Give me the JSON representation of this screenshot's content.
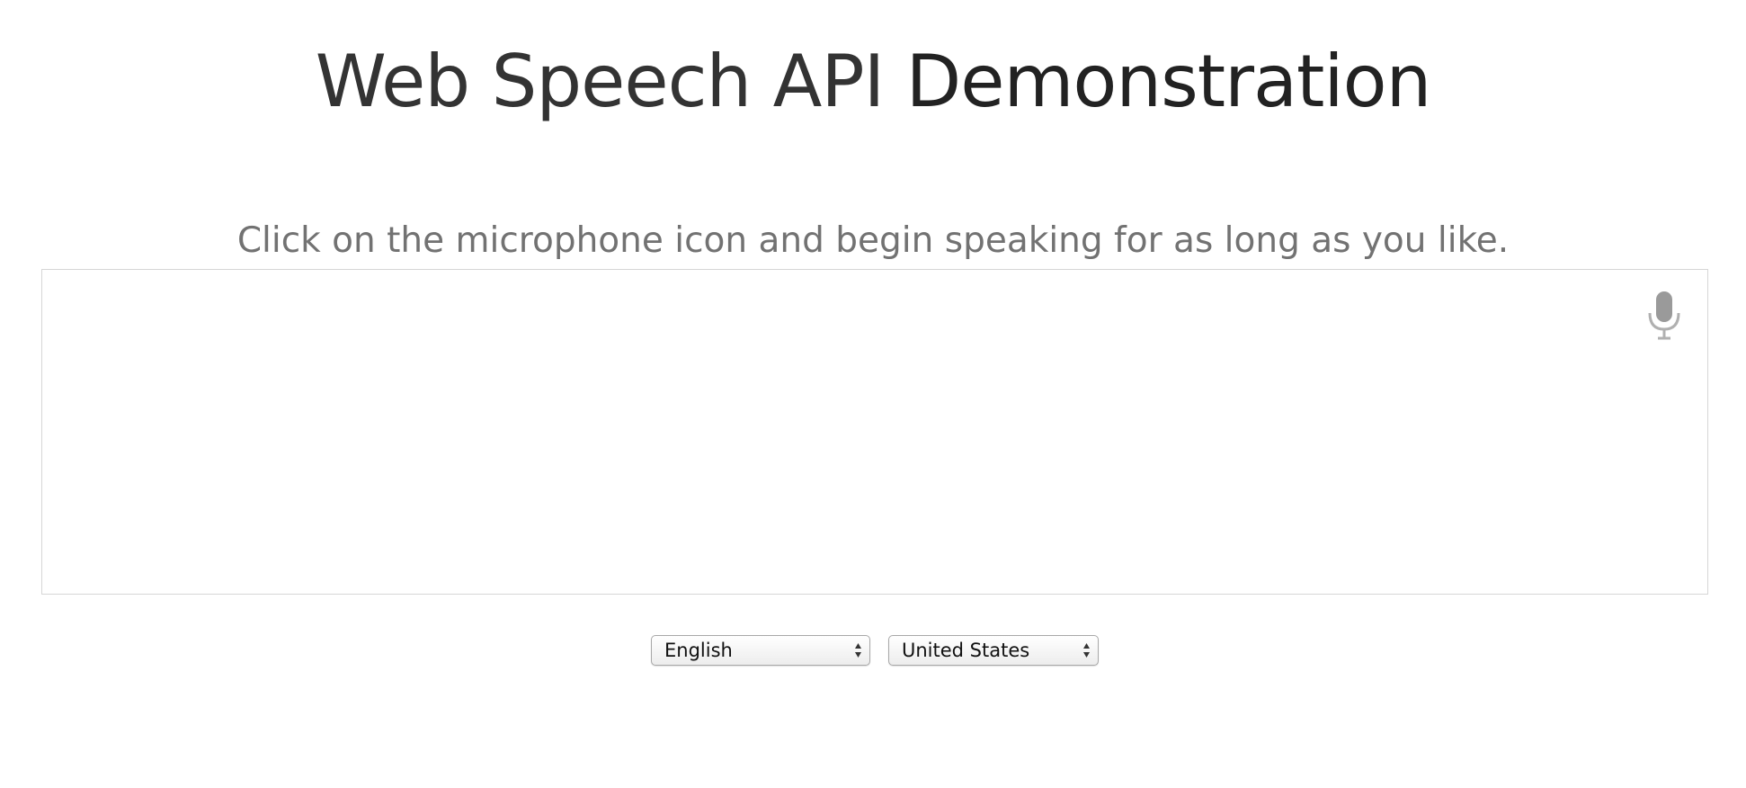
{
  "page": {
    "title_bold": "Web Speech API",
    "title_light": " Demonstration",
    "instructions": "Click on the microphone icon and begin speaking for as long as you like."
  },
  "results": {
    "final_text": "",
    "interim_text": ""
  },
  "mic": {
    "icon": "microphone-icon",
    "color": "#9a9a9a"
  },
  "controls": {
    "language": {
      "selected": "English"
    },
    "dialect": {
      "selected": "United States"
    }
  },
  "colors": {
    "title": "#333333",
    "instructions": "#727272",
    "box_border": "#d6d6d6"
  }
}
